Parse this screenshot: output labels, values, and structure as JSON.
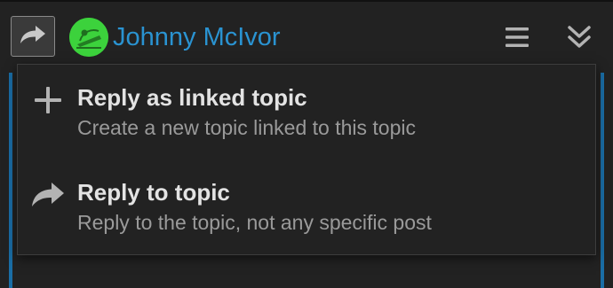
{
  "header": {
    "username": "Johnny McIvor",
    "reply_type_icon": "share-arrow-icon",
    "avatar_icon": "user-avatar",
    "menu_icon": "hamburger-icon",
    "collapse_icon": "double-chevron-down-icon"
  },
  "menu": {
    "items": [
      {
        "icon": "plus-icon",
        "title": "Reply as linked topic",
        "description": "Create a new topic linked to this topic"
      },
      {
        "icon": "share-arrow-icon",
        "title": "Reply to topic",
        "description": "Reply to the topic, not any specific post"
      }
    ]
  },
  "colors": {
    "background": "#222222",
    "accent": "#2a93d1",
    "composer_border": "#1a6ea6",
    "avatar_bg": "#3cd23c",
    "title_text": "#e3e3e3",
    "description_text": "#9a9a9a",
    "icon": "#b3b3b3"
  }
}
